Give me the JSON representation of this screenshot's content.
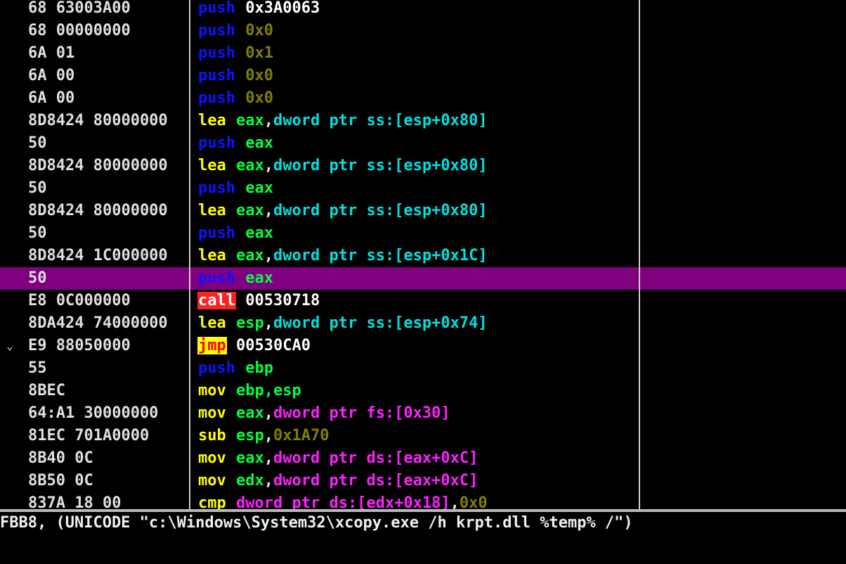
{
  "colors": {
    "background": "#000000",
    "selected_row": "#800080",
    "mnemonic_push": "#1010ff",
    "mnemonic_mov_lea": "#ffff00",
    "mnemonic_call_bg": "#ff2020",
    "mnemonic_jmp_bg": "#ffff00",
    "register": "#00ff40",
    "memory_operand": "#00e0e0",
    "memory_fs_ds": "#ff20ff",
    "immediate": "#808000",
    "address": "#ffffff",
    "bytes_text": "#e0e0e0"
  },
  "disassembly": {
    "rows": [
      {
        "bytes": "68 63003A00",
        "tokens": [
          {
            "t": "push",
            "c": "mn-push"
          },
          {
            "t": " ",
            "c": "sp"
          },
          {
            "t": "0x3A0063",
            "c": "addr"
          }
        ]
      },
      {
        "bytes": "68 00000000",
        "tokens": [
          {
            "t": "push",
            "c": "mn-push"
          },
          {
            "t": " ",
            "c": "sp"
          },
          {
            "t": "0x0",
            "c": "imm"
          }
        ]
      },
      {
        "bytes": "6A 01",
        "tokens": [
          {
            "t": "push",
            "c": "mn-push"
          },
          {
            "t": " ",
            "c": "sp"
          },
          {
            "t": "0x1",
            "c": "imm"
          }
        ]
      },
      {
        "bytes": "6A 00",
        "tokens": [
          {
            "t": "push",
            "c": "mn-push"
          },
          {
            "t": " ",
            "c": "sp"
          },
          {
            "t": "0x0",
            "c": "imm"
          }
        ]
      },
      {
        "bytes": "6A 00",
        "tokens": [
          {
            "t": "push",
            "c": "mn-push"
          },
          {
            "t": " ",
            "c": "sp"
          },
          {
            "t": "0x0",
            "c": "imm"
          }
        ]
      },
      {
        "bytes": "8D8424 80000000",
        "tokens": [
          {
            "t": "lea",
            "c": "mn-mov"
          },
          {
            "t": " ",
            "c": "sp"
          },
          {
            "t": "eax",
            "c": "reg"
          },
          {
            "t": ",",
            "c": "punct"
          },
          {
            "t": "dword ptr ss:[esp+0x80]",
            "c": "mem"
          }
        ]
      },
      {
        "bytes": "50",
        "tokens": [
          {
            "t": "push",
            "c": "mn-push"
          },
          {
            "t": " ",
            "c": "sp"
          },
          {
            "t": "eax",
            "c": "reg"
          }
        ]
      },
      {
        "bytes": "8D8424 80000000",
        "tokens": [
          {
            "t": "lea",
            "c": "mn-mov"
          },
          {
            "t": " ",
            "c": "sp"
          },
          {
            "t": "eax",
            "c": "reg"
          },
          {
            "t": ",",
            "c": "punct"
          },
          {
            "t": "dword ptr ss:[esp+0x80]",
            "c": "mem"
          }
        ]
      },
      {
        "bytes": "50",
        "tokens": [
          {
            "t": "push",
            "c": "mn-push"
          },
          {
            "t": " ",
            "c": "sp"
          },
          {
            "t": "eax",
            "c": "reg"
          }
        ]
      },
      {
        "bytes": "8D8424 80000000",
        "tokens": [
          {
            "t": "lea",
            "c": "mn-mov"
          },
          {
            "t": " ",
            "c": "sp"
          },
          {
            "t": "eax",
            "c": "reg"
          },
          {
            "t": ",",
            "c": "punct"
          },
          {
            "t": "dword ptr ss:[esp+0x80]",
            "c": "mem"
          }
        ]
      },
      {
        "bytes": "50",
        "tokens": [
          {
            "t": "push",
            "c": "mn-push"
          },
          {
            "t": " ",
            "c": "sp"
          },
          {
            "t": "eax",
            "c": "reg"
          }
        ]
      },
      {
        "bytes": "8D8424 1C000000",
        "tokens": [
          {
            "t": "lea",
            "c": "mn-mov"
          },
          {
            "t": " ",
            "c": "sp"
          },
          {
            "t": "eax",
            "c": "reg"
          },
          {
            "t": ",",
            "c": "punct"
          },
          {
            "t": "dword ptr ss:[esp+0x1C]",
            "c": "mem"
          }
        ]
      },
      {
        "bytes": "50",
        "selected": true,
        "tokens": [
          {
            "t": "push",
            "c": "mn-push"
          },
          {
            "t": " ",
            "c": "sp"
          },
          {
            "t": "eax",
            "c": "reg"
          }
        ]
      },
      {
        "bytes": "E8 0C000000",
        "tokens": [
          {
            "t": "call",
            "c": "mn-call"
          },
          {
            "t": " ",
            "c": "sp"
          },
          {
            "t": "00530718",
            "c": "addr"
          }
        ]
      },
      {
        "bytes": "8DA424 74000000",
        "tokens": [
          {
            "t": "lea",
            "c": "mn-mov"
          },
          {
            "t": " ",
            "c": "sp"
          },
          {
            "t": "esp",
            "c": "reg"
          },
          {
            "t": ",",
            "c": "punct"
          },
          {
            "t": "dword ptr ss:[esp+0x74]",
            "c": "mem"
          }
        ]
      },
      {
        "bytes": "E9 88050000",
        "arrow": "⌄",
        "tokens": [
          {
            "t": "jmp",
            "c": "mn-jmp"
          },
          {
            "t": " ",
            "c": "sp"
          },
          {
            "t": "00530CA0",
            "c": "addr"
          }
        ]
      },
      {
        "bytes": "55",
        "tokens": [
          {
            "t": "push",
            "c": "mn-push"
          },
          {
            "t": " ",
            "c": "sp"
          },
          {
            "t": "ebp",
            "c": "reg"
          }
        ]
      },
      {
        "bytes": "8BEC",
        "tokens": [
          {
            "t": "mov",
            "c": "mn-mov"
          },
          {
            "t": " ",
            "c": "sp"
          },
          {
            "t": "ebp,esp",
            "c": "reg"
          }
        ]
      },
      {
        "bytes": "64:A1 30000000",
        "tokens": [
          {
            "t": "mov",
            "c": "mn-mov"
          },
          {
            "t": " ",
            "c": "sp"
          },
          {
            "t": "eax",
            "c": "reg"
          },
          {
            "t": ",",
            "c": "punct"
          },
          {
            "t": "dword ptr fs:[0x30]",
            "c": "mem2"
          }
        ]
      },
      {
        "bytes": "81EC 701A0000",
        "tokens": [
          {
            "t": "sub",
            "c": "mn-mov"
          },
          {
            "t": " ",
            "c": "sp"
          },
          {
            "t": "esp",
            "c": "reg"
          },
          {
            "t": ",",
            "c": "punct"
          },
          {
            "t": "0x1A70",
            "c": "imm"
          }
        ]
      },
      {
        "bytes": "8B40 0C",
        "tokens": [
          {
            "t": "mov",
            "c": "mn-mov"
          },
          {
            "t": " ",
            "c": "sp"
          },
          {
            "t": "eax",
            "c": "reg"
          },
          {
            "t": ",",
            "c": "punct"
          },
          {
            "t": "dword ptr ds:[eax+0xC]",
            "c": "mem2"
          }
        ]
      },
      {
        "bytes": "8B50 0C",
        "tokens": [
          {
            "t": "mov",
            "c": "mn-mov"
          },
          {
            "t": " ",
            "c": "sp"
          },
          {
            "t": "edx",
            "c": "reg"
          },
          {
            "t": ",",
            "c": "punct"
          },
          {
            "t": "dword ptr ds:[eax+0xC]",
            "c": "mem2"
          }
        ]
      },
      {
        "bytes": "837A 18 00",
        "tokens": [
          {
            "t": "cmp",
            "c": "mn-mov"
          },
          {
            "t": " ",
            "c": "sp"
          },
          {
            "t": "dword ptr ds:[edx+0x18]",
            "c": "mem2"
          },
          {
            "t": ",",
            "c": "punct"
          },
          {
            "t": "0x0",
            "c": "imm"
          }
        ]
      }
    ]
  },
  "info_pane": {
    "text": "FBB8, (UNICODE \"c:\\Windows\\System32\\xcopy.exe /h krpt.dll %temp% /\")"
  }
}
